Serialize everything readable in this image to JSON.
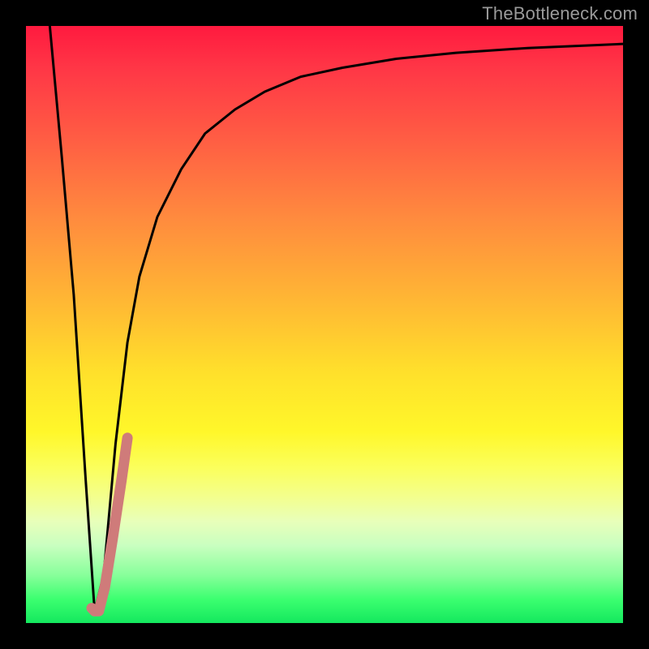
{
  "watermark": "TheBottleneck.com",
  "colors": {
    "frame": "#000000",
    "curve_black": "#000000",
    "curve_pink": "#cf7b7a",
    "gradient_stops": [
      "#ff1a3f",
      "#ff3646",
      "#ff5a44",
      "#ff8a3e",
      "#ffb734",
      "#ffe02b",
      "#fff72a",
      "#fbff5c",
      "#f3ff8f",
      "#e8ffba",
      "#c9ffc0",
      "#87ff9a",
      "#3cff70",
      "#14e85e"
    ]
  },
  "chart_data": {
    "type": "line",
    "title": "",
    "xlabel": "",
    "ylabel": "",
    "xlim": [
      0,
      100
    ],
    "ylim": [
      0,
      100
    ],
    "grid": false,
    "legend": false,
    "notes": "Axes unlabeled; values estimated from pixel positions within the 736x736 plot area. y=0 at bottom, y=100 at top.",
    "series": [
      {
        "name": "black-v-curve",
        "color": "#000000",
        "x": [
          4,
          6,
          8,
          10,
          11.5,
          13,
          15,
          17,
          19,
          22,
          26,
          30,
          35,
          40,
          46,
          53,
          62,
          72,
          84,
          100
        ],
        "y": [
          100,
          78,
          55,
          24,
          2,
          8,
          30,
          47,
          58,
          68,
          76,
          82,
          86,
          89,
          91.5,
          93,
          94.5,
          95.5,
          96.3,
          97
        ]
      },
      {
        "name": "pink-hook-overlay",
        "color": "#cf7b7a",
        "x": [
          11.0,
          11.5,
          12.2,
          13.2,
          14.5,
          16.0,
          17.0
        ],
        "y": [
          2.5,
          2.0,
          2.0,
          6.0,
          14.0,
          24.0,
          31.0
        ]
      }
    ]
  }
}
